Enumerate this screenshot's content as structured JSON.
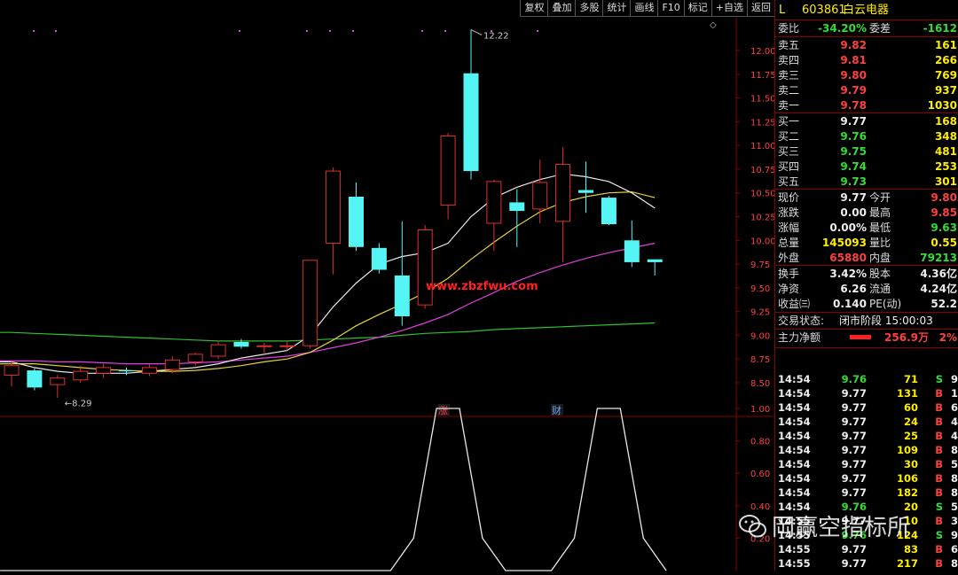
{
  "toolbar": {
    "items": [
      "复权",
      "叠加",
      "多股",
      "统计",
      "画线",
      "F10",
      "标记",
      "+自选",
      "返回"
    ]
  },
  "chart_data": {
    "type": "candlestick",
    "price_axis": {
      "ticks": [
        12.0,
        11.75,
        11.5,
        11.25,
        11.0,
        10.75,
        10.5,
        10.25,
        10.0,
        9.75,
        9.5,
        9.25,
        9.0,
        8.75,
        8.5
      ]
    },
    "indicator_axis": {
      "ticks": [
        1.0,
        0.8,
        0.6,
        0.4,
        0.2
      ]
    },
    "high_label": "12.22",
    "low_label": "8.29",
    "watermark_text": "www.zbzfwu.com",
    "event_marks": [
      "涨",
      "财"
    ],
    "candles": [
      {
        "o": 8.58,
        "h": 8.74,
        "l": 8.46,
        "c": 8.68
      },
      {
        "o": 8.63,
        "h": 8.65,
        "l": 8.42,
        "c": 8.45
      },
      {
        "o": 8.48,
        "h": 8.58,
        "l": 8.34,
        "c": 8.55
      },
      {
        "o": 8.53,
        "h": 8.68,
        "l": 8.5,
        "c": 8.62
      },
      {
        "o": 8.6,
        "h": 8.7,
        "l": 8.55,
        "c": 8.66
      },
      {
        "o": 8.63,
        "h": 8.66,
        "l": 8.58,
        "c": 8.62
      },
      {
        "o": 8.6,
        "h": 8.7,
        "l": 8.57,
        "c": 8.66
      },
      {
        "o": 8.64,
        "h": 8.78,
        "l": 8.6,
        "c": 8.74
      },
      {
        "o": 8.72,
        "h": 8.82,
        "l": 8.68,
        "c": 8.8
      },
      {
        "o": 8.78,
        "h": 8.93,
        "l": 8.75,
        "c": 8.9
      },
      {
        "o": 8.93,
        "h": 8.96,
        "l": 8.86,
        "c": 8.88
      },
      {
        "o": 8.88,
        "h": 8.92,
        "l": 8.8,
        "c": 8.89
      },
      {
        "o": 8.89,
        "h": 8.94,
        "l": 8.84,
        "c": 8.89
      },
      {
        "o": 8.89,
        "h": 9.79,
        "l": 8.86,
        "c": 9.79
      },
      {
        "o": 9.97,
        "h": 10.77,
        "l": 9.64,
        "c": 10.73
      },
      {
        "o": 10.46,
        "h": 10.61,
        "l": 9.89,
        "c": 9.93
      },
      {
        "o": 9.92,
        "h": 9.97,
        "l": 9.65,
        "c": 9.69
      },
      {
        "o": 9.63,
        "h": 10.2,
        "l": 9.1,
        "c": 9.2
      },
      {
        "o": 9.32,
        "h": 10.16,
        "l": 9.28,
        "c": 10.11
      },
      {
        "o": 10.37,
        "h": 11.13,
        "l": 10.22,
        "c": 11.1
      },
      {
        "o": 11.76,
        "h": 12.22,
        "l": 10.64,
        "c": 10.73
      },
      {
        "o": 10.18,
        "h": 10.64,
        "l": 9.89,
        "c": 10.62
      },
      {
        "o": 10.4,
        "h": 10.54,
        "l": 9.93,
        "c": 10.31
      },
      {
        "o": 10.33,
        "h": 10.85,
        "l": 10.18,
        "c": 10.61
      },
      {
        "o": 10.2,
        "h": 10.98,
        "l": 9.77,
        "c": 10.8
      },
      {
        "o": 10.53,
        "h": 10.83,
        "l": 10.29,
        "c": 10.5
      },
      {
        "o": 10.45,
        "h": 10.47,
        "l": 10.16,
        "c": 10.17
      },
      {
        "o": 10.0,
        "h": 10.21,
        "l": 9.72,
        "c": 9.77
      },
      {
        "o": 9.8,
        "h": 9.8,
        "l": 9.63,
        "c": 9.77
      }
    ],
    "ma_white": [
      8.72,
      8.66,
      8.62,
      8.6,
      8.6,
      8.6,
      8.62,
      8.64,
      8.66,
      8.7,
      8.76,
      8.8,
      8.84,
      9.0,
      9.3,
      9.55,
      9.75,
      9.83,
      9.87,
      9.97,
      10.25,
      10.45,
      10.56,
      10.64,
      10.7,
      10.67,
      10.62,
      10.5,
      10.34
    ],
    "ma_yellow": [
      8.7,
      8.7,
      8.68,
      8.66,
      8.64,
      8.63,
      8.62,
      8.62,
      8.63,
      8.65,
      8.68,
      8.72,
      8.75,
      8.82,
      8.95,
      9.1,
      9.22,
      9.33,
      9.45,
      9.6,
      9.8,
      9.98,
      10.15,
      10.3,
      10.4,
      10.46,
      10.5,
      10.51,
      10.45
    ],
    "ma_magenta": [
      8.73,
      8.73,
      8.72,
      8.72,
      8.71,
      8.7,
      8.7,
      8.7,
      8.71,
      8.72,
      8.74,
      8.76,
      8.78,
      8.82,
      8.87,
      8.92,
      8.98,
      9.05,
      9.13,
      9.22,
      9.34,
      9.45,
      9.57,
      9.66,
      9.74,
      9.81,
      9.87,
      9.92,
      9.97
    ],
    "ma_green": [
      9.03,
      9.02,
      9.01,
      9.0,
      8.99,
      8.98,
      8.97,
      8.96,
      8.95,
      8.94,
      8.94,
      8.94,
      8.94,
      8.95,
      8.96,
      8.97,
      8.98,
      9.0,
      9.02,
      9.03,
      9.04,
      9.06,
      9.07,
      9.08,
      9.09,
      9.1,
      9.11,
      9.12,
      9.13
    ],
    "indicator_line": [
      0,
      0,
      0,
      0,
      0,
      0,
      0,
      0,
      0,
      0,
      0,
      0,
      0,
      0,
      0,
      0,
      0,
      0,
      0.2,
      1,
      1,
      0.2,
      0,
      0,
      0,
      0.2,
      1,
      1,
      0.2,
      0
    ],
    "indicator_note": "signal shape"
  },
  "quote": {
    "prefix": "L",
    "code": "603861",
    "name": "白云电器",
    "ratio_label": "委比",
    "ratio_value": "-34.20%",
    "diff_label": "委差",
    "diff_value": "-1612",
    "sells": [
      {
        "label": "卖五",
        "price": "9.82",
        "vol": "161"
      },
      {
        "label": "卖四",
        "price": "9.81",
        "vol": "266"
      },
      {
        "label": "卖三",
        "price": "9.80",
        "vol": "769"
      },
      {
        "label": "卖二",
        "price": "9.79",
        "vol": "937"
      },
      {
        "label": "卖一",
        "price": "9.78",
        "vol": "1030"
      }
    ],
    "buys": [
      {
        "label": "买一",
        "price": "9.77",
        "vol": "168",
        "color": "white"
      },
      {
        "label": "买二",
        "price": "9.76",
        "vol": "348",
        "color": "green"
      },
      {
        "label": "买三",
        "price": "9.75",
        "vol": "481",
        "color": "green"
      },
      {
        "label": "买四",
        "price": "9.74",
        "vol": "253",
        "color": "green"
      },
      {
        "label": "买五",
        "price": "9.73",
        "vol": "301",
        "color": "green"
      }
    ],
    "stats": [
      {
        "l1": "现价",
        "v1": "9.77",
        "c1": "white",
        "l2": "今开",
        "v2": "9.80",
        "c2": "red"
      },
      {
        "l1": "涨跌",
        "v1": "0.00",
        "c1": "white",
        "l2": "最高",
        "v2": "9.85",
        "c2": "red"
      },
      {
        "l1": "涨幅",
        "v1": "0.00%",
        "c1": "white",
        "l2": "最低",
        "v2": "9.63",
        "c2": "green"
      },
      {
        "l1": "总量",
        "v1": "145093",
        "c1": "yellow",
        "l2": "量比",
        "v2": "0.55",
        "c2": "yellow"
      },
      {
        "l1": "外盘",
        "v1": "65880",
        "c1": "red",
        "l2": "内盘",
        "v2": "79213",
        "c2": "green"
      }
    ],
    "stats2": [
      {
        "l1": "换手",
        "v1": "3.42%",
        "l2": "股本",
        "v2": "4.36亿"
      },
      {
        "l1": "净资",
        "v1": "6.26",
        "l2": "流通",
        "v2": "4.24亿"
      },
      {
        "l1": "收益㈢",
        "v1": "0.140",
        "l2": "PE(动)",
        "v2": "52.2"
      }
    ],
    "status_label": "交易状态:",
    "status_value": "闭市阶段 15:00:03",
    "main_flow_label": "主力净额",
    "main_flow_value": "256.9万",
    "main_flow_pct": "2%"
  },
  "trades": [
    {
      "t": "14:54",
      "p": "9.76",
      "pc": "green",
      "v": "71",
      "s": "S",
      "sc": "green",
      "n": "9"
    },
    {
      "t": "14:54",
      "p": "9.77",
      "pc": "white",
      "v": "131",
      "s": "B",
      "sc": "red",
      "n": "15"
    },
    {
      "t": "14:54",
      "p": "9.77",
      "pc": "white",
      "v": "60",
      "s": "B",
      "sc": "red",
      "n": "6"
    },
    {
      "t": "14:54",
      "p": "9.77",
      "pc": "white",
      "v": "24",
      "s": "B",
      "sc": "red",
      "n": "4"
    },
    {
      "t": "14:54",
      "p": "9.77",
      "pc": "white",
      "v": "25",
      "s": "B",
      "sc": "red",
      "n": "4"
    },
    {
      "t": "14:54",
      "p": "9.77",
      "pc": "white",
      "v": "109",
      "s": "B",
      "sc": "red",
      "n": "8"
    },
    {
      "t": "14:54",
      "p": "9.77",
      "pc": "white",
      "v": "30",
      "s": "B",
      "sc": "red",
      "n": "5"
    },
    {
      "t": "14:54",
      "p": "9.77",
      "pc": "white",
      "v": "106",
      "s": "B",
      "sc": "red",
      "n": "8"
    },
    {
      "t": "14:54",
      "p": "9.77",
      "pc": "white",
      "v": "182",
      "s": "B",
      "sc": "red",
      "n": "8"
    },
    {
      "t": "14:54",
      "p": "9.76",
      "pc": "green",
      "v": "20",
      "s": "S",
      "sc": "green",
      "n": "5"
    },
    {
      "t": "14:55",
      "p": "9.77",
      "pc": "white",
      "v": "10",
      "s": "B",
      "sc": "red",
      "n": "3"
    },
    {
      "t": "14:55",
      "p": "9.76",
      "pc": "green",
      "v": "124",
      "s": "S",
      "sc": "green",
      "n": "9"
    },
    {
      "t": "14:55",
      "p": "9.77",
      "pc": "white",
      "v": "83",
      "s": "B",
      "sc": "red",
      "n": "6"
    },
    {
      "t": "14:55",
      "p": "9.77",
      "pc": "white",
      "v": "217",
      "s": "B",
      "sc": "red",
      "n": "8"
    },
    {
      "t": "14:55",
      "p": "9.77",
      "pc": "white",
      "v": "273",
      "s": "B",
      "sc": "red",
      "n": "17"
    }
  ],
  "watermark": {
    "text": "岡赢空指标所"
  },
  "colors": {
    "up": "#e03030",
    "down": "#55f5f5",
    "ma_white": "#e8e8e8",
    "ma_yellow": "#e6d23a",
    "ma_magenta": "#e040e0",
    "ma_green": "#30c030",
    "axis": "#8a0000"
  }
}
